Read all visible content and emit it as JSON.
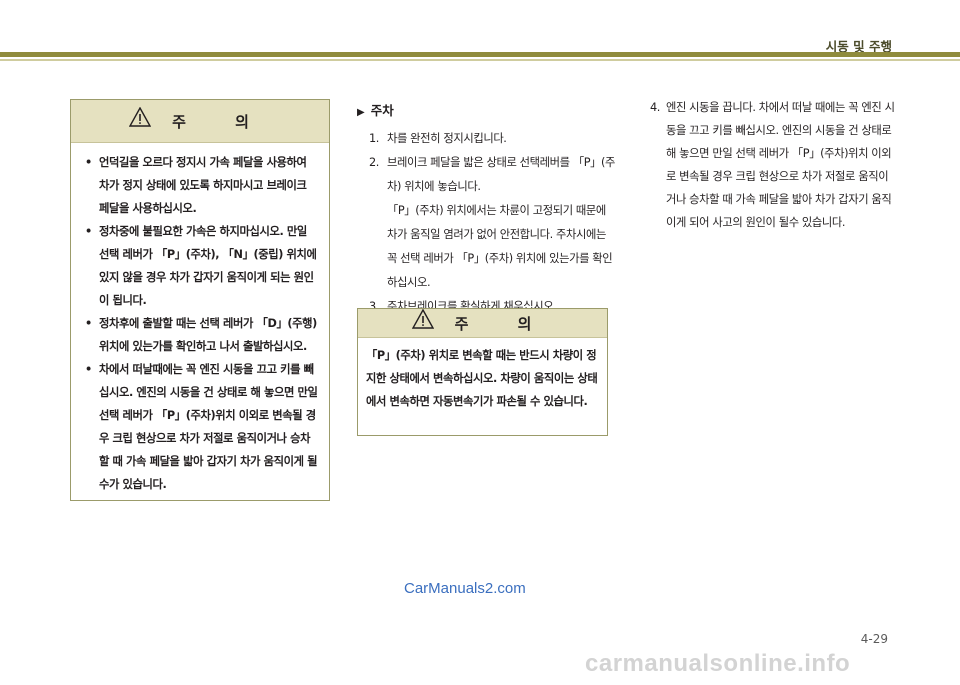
{
  "header": {
    "title": "시동 및 주행",
    "accent_color": "#8f8b3c"
  },
  "caution_left": {
    "icon": "warning-triangle-icon",
    "title": "주 의",
    "bullets": [
      "언덕길을 오르다 정지시 가속 페달을 사용하여 차가 정지 상태에 있도록 하지마시고 브레이크 페달을 사용하십시오.",
      "정차중에 불필요한 가속은 하지마십시오. 만일 선택 레버가 「P」(주차), 「N」(중립) 위치에 있지 않을 경우 차가 갑자기 움직이게 되는 원인이 됩니다.",
      "정차후에 출발할 때는 선택 레버가 「D」(주행) 위치에 있는가를 확인하고 나서 출발하십시오.",
      "차에서 떠날때에는 꼭 엔진 시동을 끄고 키를 빼십시오. 엔진의 시동을 건 상태로 해 놓으면 만일 선택 레버가 「P」(주차)위치 이외로 변속될 경우 크립 현상으로 차가 저절로 움직이거나 승차할 때 가속 페달을 밟아 갑자기 차가 움직이게 될 수가 있습니다."
    ]
  },
  "parking": {
    "heading_marker": "▶",
    "heading": "주차",
    "steps": [
      {
        "num": "1.",
        "lines": [
          "차를 완전히 정지시킵니다."
        ]
      },
      {
        "num": "2.",
        "lines": [
          "브레이크 페달을 밟은 상태로 선택레버를 「P」(주차) 위치에 놓습니다.",
          "「P」(주차) 위치에서는 차륜이 고정되기 때문에 차가 움직일 염려가 없어 안전합니다. 주차시에는 꼭 선택 레버가 「P」(주차) 위치에 있는가를 확인하십시오."
        ]
      },
      {
        "num": "3.",
        "lines": [
          "주차브레이크를 확실하게 채우십시오."
        ]
      }
    ]
  },
  "caution_mid": {
    "icon": "warning-triangle-icon",
    "title": "주 의",
    "text": "「P」(주차) 위치로 변속할 때는 반드시 차량이 정지한 상태에서 변속하십시오. 차량이 움직이는 상태에서 변속하면 자동변속기가 파손될 수 있습니다."
  },
  "step4": {
    "num": "4.",
    "text": "엔진 시동을 끕니다. 차에서 떠날 때에는 꼭 엔진 시동을 끄고 키를 빼십시오. 엔진의 시동을 건 상태로 해 놓으면 만일 선택 레버가 「P」(주차)위치 이외로 변속될 경우 크립 현상으로 차가 저절로 움직이거나 승차할 때 가속 페달을 밟아 차가 갑자기 움직이게 되어 사고의 원인이 될수 있습니다."
  },
  "watermark": "CarManuals2.com",
  "page_number": "4-29",
  "footer_watermark": "carmanualsonline.info"
}
